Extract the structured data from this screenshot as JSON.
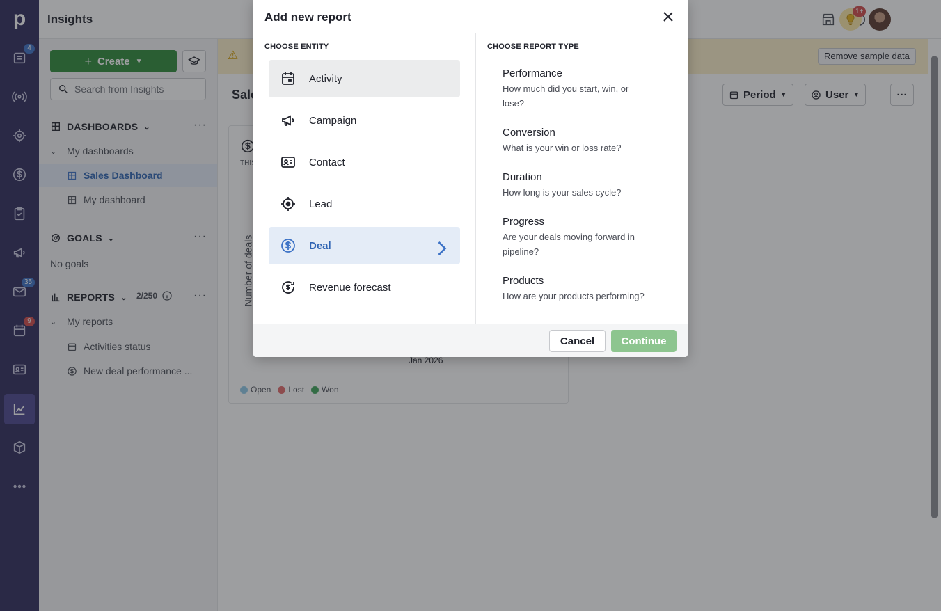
{
  "app": {
    "logo": "p",
    "title": "Insights"
  },
  "rail": {
    "badges": {
      "leads": "4",
      "mail": "35",
      "activities": "9"
    }
  },
  "topbar": {
    "notification_badge": "1+"
  },
  "sidebar": {
    "create_label": "Create",
    "search_placeholder": "Search from Insights",
    "dashboards_heading": "DASHBOARDS",
    "my_dashboards": "My dashboards",
    "dashboard_items": [
      "Sales Dashboard",
      "My dashboard"
    ],
    "goals_heading": "GOALS",
    "no_goals": "No goals",
    "reports_heading": "REPORTS",
    "reports_usage": "2/250",
    "my_reports": "My reports",
    "report_items": [
      "Activities status",
      "New deal performance ..."
    ]
  },
  "main": {
    "banner_button": "Remove sample data",
    "title": "Sale",
    "filters": {
      "period": "Period",
      "user": "User"
    },
    "card": {
      "period_label": "THIS",
      "y_axis": "Number of deals",
      "x_label": "Jan 2026",
      "legend": [
        "Open",
        "Lost",
        "Won"
      ]
    }
  },
  "modal": {
    "title": "Add new report",
    "entity_label": "CHOOSE ENTITY",
    "report_type_label": "CHOOSE REPORT TYPE",
    "entities": [
      "Activity",
      "Campaign",
      "Contact",
      "Lead",
      "Deal",
      "Revenue forecast"
    ],
    "selected_entity": "Deal",
    "report_types": [
      {
        "name": "Performance",
        "desc": "How much did you start, win, or lose?"
      },
      {
        "name": "Conversion",
        "desc": "What is your win or loss rate?"
      },
      {
        "name": "Duration",
        "desc": "How long is your sales cycle?"
      },
      {
        "name": "Progress",
        "desc": "Are your deals moving forward in pipeline?"
      },
      {
        "name": "Products",
        "desc": "How are your products performing?"
      }
    ],
    "cancel_label": "Cancel",
    "continue_label": "Continue"
  },
  "colors": {
    "brand_green": "#2f8a3a",
    "continue_disabled": "#8dc58f",
    "accent_blue": "#3c72c6",
    "rail_bg": "#2e2a5c",
    "legend_open": "#8ec9e8",
    "legend_lost": "#e26a6a",
    "legend_won": "#3fa55a"
  }
}
